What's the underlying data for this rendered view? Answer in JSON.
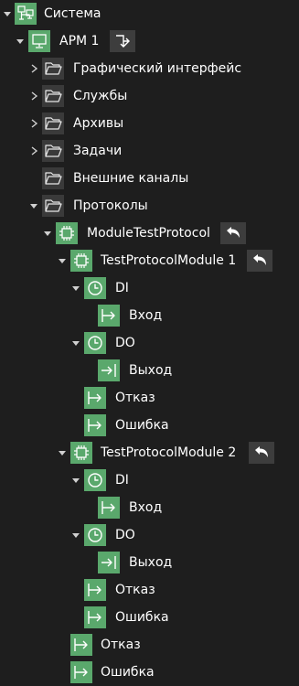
{
  "tree": {
    "system": "Система",
    "arm": "АРМ 1",
    "gui": "Графический интерфейс",
    "services": "Службы",
    "archives": "Архивы",
    "tasks": "Задачи",
    "external": "Внешние каналы",
    "protocols": "Протоколы",
    "mtp": "ModuleTestProtocol",
    "mod1": {
      "name": "TestProtocolModule 1",
      "di": "DI",
      "di_in": "Вход",
      "do": "DO",
      "do_out": "Выход",
      "fail": "Отказ",
      "err": "Ошибка"
    },
    "mod2": {
      "name": "TestProtocolModule 2",
      "di": "DI",
      "di_in": "Вход",
      "do": "DO",
      "do_out": "Выход",
      "fail": "Отказ",
      "err": "Ошибка"
    },
    "fail": "Отказ",
    "err": "Ошибка"
  },
  "colors": {
    "background": "#1e1e1e",
    "accent": "#5aa86c",
    "icon_dark": "#3a3a3a",
    "action_bg": "#3d3d3d",
    "text": "#ffffff"
  }
}
